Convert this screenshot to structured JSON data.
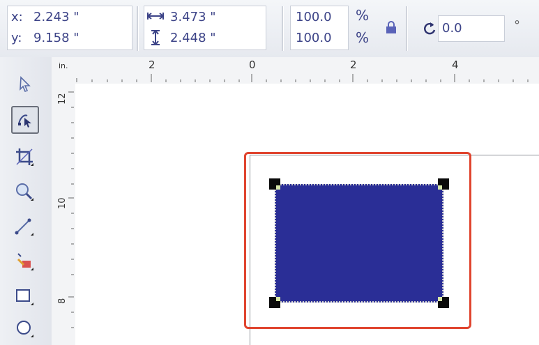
{
  "propbar": {
    "x_label": "x:",
    "x_value": "2.243 \"",
    "y_label": "y:",
    "y_value": "9.158 \"",
    "width_value": "3.473 \"",
    "height_value": "2.448 \"",
    "scale_x": "100.0",
    "scale_y": "100.0",
    "percent_x": "%",
    "percent_y": "%",
    "rotation_value": "0.0",
    "degree_symbol": "°"
  },
  "ruler": {
    "h_labels": [
      "2",
      "0",
      "2",
      "4"
    ],
    "h_unit": "in.",
    "v_labels": [
      "12",
      "10",
      "8"
    ]
  },
  "toolbox": {
    "tools": [
      "pick-tool",
      "shape-tool",
      "crop-tool",
      "zoom-tool",
      "freehand-tool",
      "smart-fill-tool",
      "rectangle-tool",
      "ellipse-tool"
    ]
  },
  "colors": {
    "rectangle_fill": "#2a2e96",
    "highlight_border": "#e0452f",
    "handle": "#0a0a0a"
  }
}
